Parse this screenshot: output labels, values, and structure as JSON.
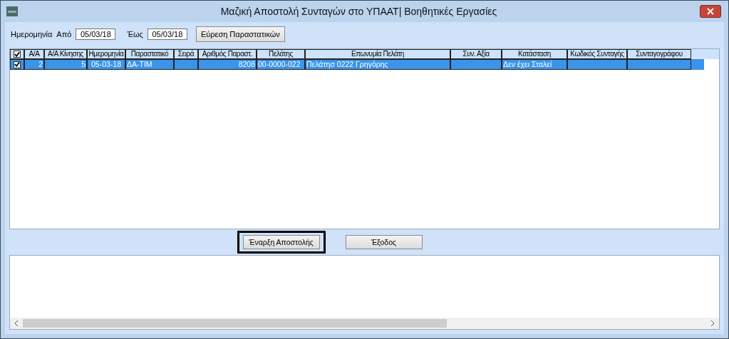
{
  "window": {
    "title": "Μαζική Αποστολή Συνταγών στο ΥΠΑΑΤ| Βοηθητικές Εργασίες"
  },
  "filter": {
    "date_label": "Ημερομηνία",
    "from_label": "Από",
    "from_value": "05/03/18",
    "to_label": "Έως",
    "to_value": "05/03/18",
    "find_button": "Εύρεση Παραστατικών"
  },
  "table": {
    "all_checked": true,
    "columns": [
      {
        "label": "Α/Α"
      },
      {
        "label": "Α/Α Κίνησης"
      },
      {
        "label": "Ημερομηνία"
      },
      {
        "label": "Παραστατικό"
      },
      {
        "label": "Σειρά"
      },
      {
        "label": "Αριθμός Παραστ."
      },
      {
        "label": "Πελάτης"
      },
      {
        "label": "Επωνυμία Πελάτη"
      },
      {
        "label": "Συν. Αξία"
      },
      {
        "label": "Κατάσταση"
      },
      {
        "label": "Κωδικός Συνταγής"
      },
      {
        "label": "Συνταγογράφου"
      }
    ],
    "rows": [
      {
        "checked": true,
        "selected": true,
        "cells": [
          "2",
          "5",
          "05-03-18",
          "ΔΑ-ΤΙΜ",
          "",
          "8208",
          "00-0000-022",
          "Πελάτησ 0222 Γρηγόρης",
          "",
          "Δεν έχει Σταλεί",
          "",
          ""
        ]
      }
    ]
  },
  "buttons": [
    {
      "label": "Έναρξη Αποστολής",
      "focused": true
    },
    {
      "label": "Έξοδος",
      "focused": false
    }
  ]
}
